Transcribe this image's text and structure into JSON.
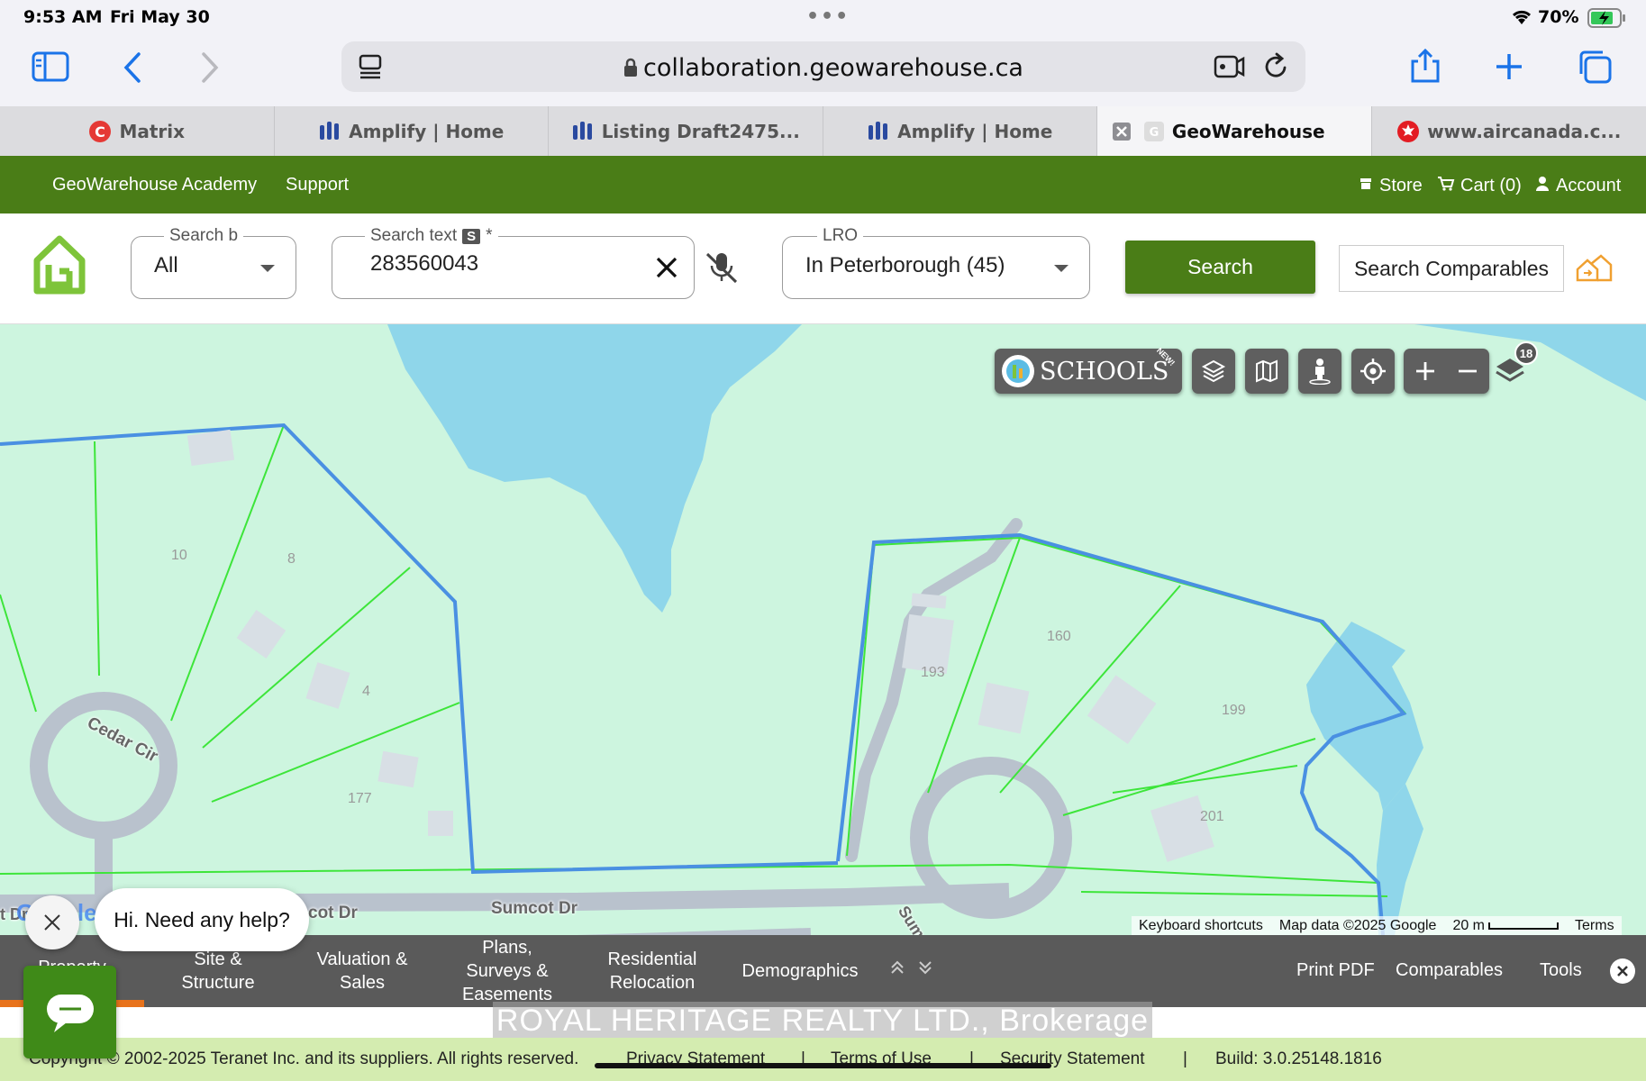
{
  "status_bar": {
    "time": "9:53 AM",
    "date": "Fri May 30",
    "battery": "70%"
  },
  "browser": {
    "url": "collaboration.geowarehouse.ca",
    "tabs": [
      {
        "label": "Matrix",
        "icon": "matrix-favicon"
      },
      {
        "label": "Amplify | Home",
        "icon": "amplify-favicon"
      },
      {
        "label": "Listing Draft2475...",
        "icon": "amplify-favicon"
      },
      {
        "label": "Amplify | Home",
        "icon": "amplify-favicon"
      },
      {
        "label": "GeoWarehouse",
        "icon": "geowarehouse-favicon",
        "active": true
      },
      {
        "label": "www.aircanada.c...",
        "icon": "aircanada-favicon"
      }
    ]
  },
  "gw_nav": {
    "academy": "GeoWarehouse Academy",
    "support": "Support",
    "store": "Store",
    "cart": "Cart (0)",
    "account": "Account"
  },
  "search": {
    "search_by_label": "Search b",
    "search_by_value": "All",
    "search_text_label": "Search text",
    "search_text_badge": "S",
    "search_text_required": "*",
    "search_text_value": "283560043",
    "lro_label": "LRO",
    "lro_value": "In Peterborough (45)",
    "search_button": "Search",
    "comparables_button": "Search Comparables"
  },
  "map": {
    "schools_label": "SCHOOLS",
    "schools_badge": "NEW!",
    "layers_count": "18",
    "parcel_labels": [
      "10",
      "8",
      "4",
      "177",
      "193",
      "160",
      "199",
      "201"
    ],
    "street_labels": [
      "Cedar Cir",
      "Sumcot Dr",
      "cot Dr",
      "Sum",
      "t Dr"
    ],
    "attribution": {
      "shortcuts": "Keyboard shortcuts",
      "map_data": "Map data ©2025 Google",
      "scale": "20 m",
      "terms": "Terms"
    },
    "google_logo": "Google",
    "colors": {
      "land": "#cdf5df",
      "water": "#8fd6ea",
      "parcel_line": "#3de53a",
      "selection": "#4a90e2",
      "road": "#b9c2cd"
    }
  },
  "chat": {
    "prompt": "Hi. Need any help?"
  },
  "property_tabs": {
    "items": [
      "Property",
      "Site &\nStructure",
      "Valuation &\nSales",
      "Plans,\nSurveys &\nEasements",
      "Residential\nRelocation",
      "Demographics"
    ],
    "print_pdf": "Print PDF",
    "comparables": "Comparables",
    "tools": "Tools"
  },
  "watermark": "ROYAL HERITAGE REALTY LTD., Brokerage",
  "footer": {
    "copyright": "Copyright © 2002-2025 Teranet Inc. and its suppliers. All rights reserved.",
    "privacy": "Privacy Statement",
    "terms": "Terms of Use",
    "security": "Security Statement",
    "separator": "|",
    "build": "Build: 3.0.25148.1816"
  }
}
